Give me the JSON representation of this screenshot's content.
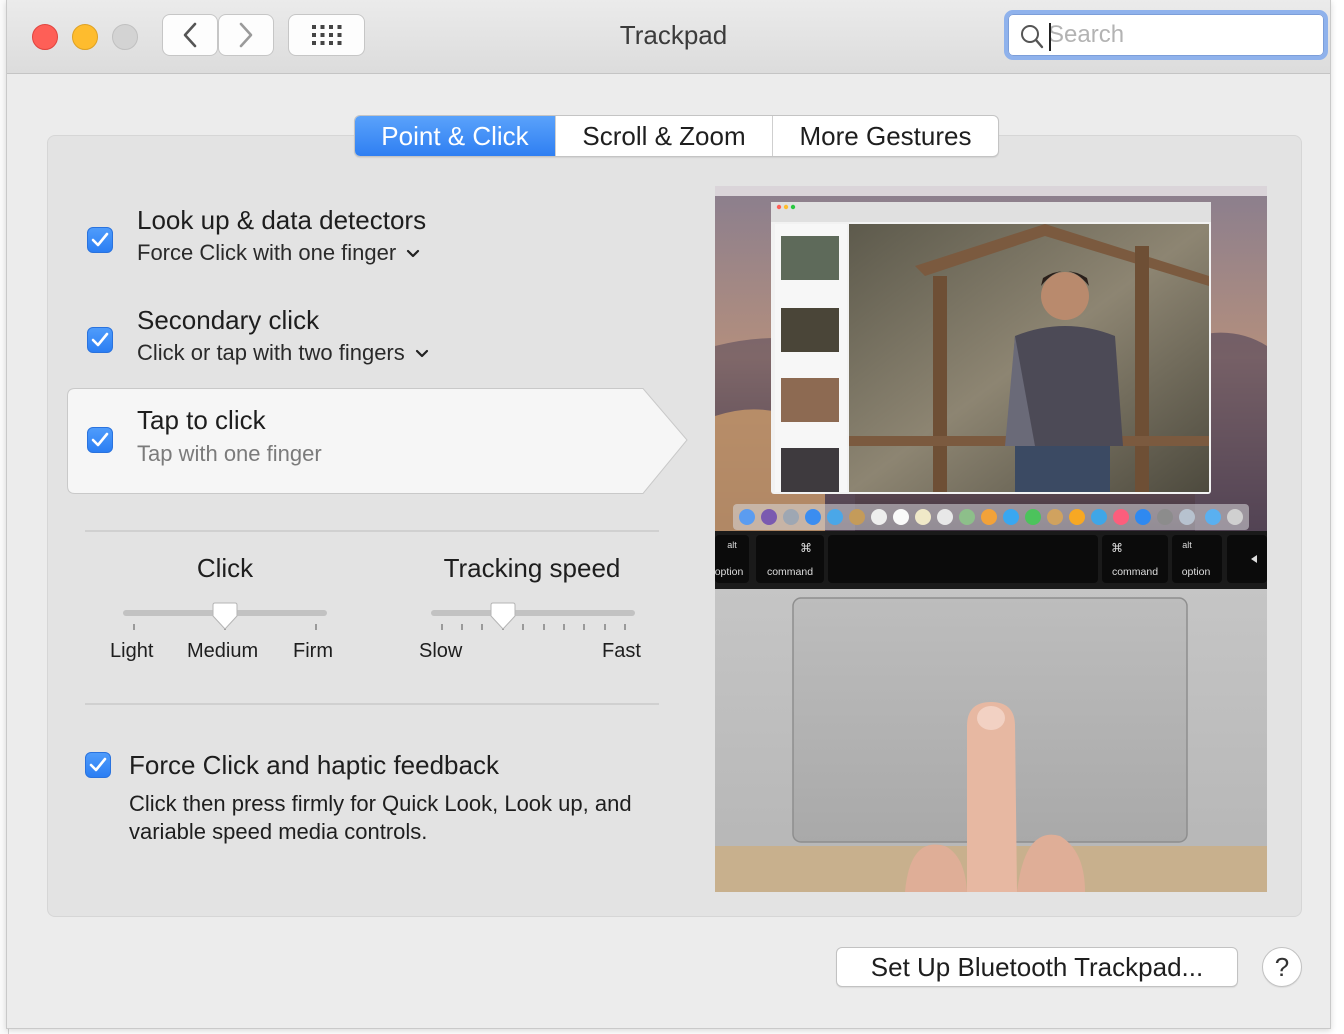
{
  "window": {
    "title": "Trackpad"
  },
  "search": {
    "placeholder": "Search",
    "value": ""
  },
  "tabs": [
    {
      "label": "Point & Click",
      "active": true
    },
    {
      "label": "Scroll & Zoom",
      "active": false
    },
    {
      "label": "More Gestures",
      "active": false
    }
  ],
  "options": [
    {
      "title": "Look up & data detectors",
      "subtitle": "Force Click with one finger",
      "checked": true,
      "has_menu": true
    },
    {
      "title": "Secondary click",
      "subtitle": "Click or tap with two fingers",
      "checked": true,
      "has_menu": true
    },
    {
      "title": "Tap to click",
      "subtitle": "Tap with one finger",
      "checked": true,
      "has_menu": false
    }
  ],
  "click_slider": {
    "label": "Click",
    "ticks": [
      "Light",
      "Medium",
      "Firm"
    ],
    "value": "Medium"
  },
  "tracking_slider": {
    "label": "Tracking speed",
    "min_label": "Slow",
    "max_label": "Fast",
    "tick_count": 10,
    "value_index": 3
  },
  "force_click": {
    "title": "Force Click and haptic feedback",
    "description": "Click then press firmly for Quick Look, Look up, and variable speed media controls.",
    "checked": true
  },
  "preview": {
    "keys": {
      "left_option_alt": "alt",
      "left_option": "option",
      "left_command_symbol": "⌘",
      "left_command": "command",
      "right_command_symbol": "⌘",
      "right_command": "command",
      "right_option_alt": "alt",
      "right_option": "option"
    }
  },
  "buttons": {
    "bluetooth": "Set Up Bluetooth Trackpad...",
    "help": "?"
  },
  "colors": {
    "accent": "#2f7ff2",
    "close": "#fe5f57",
    "minimize": "#febc2e",
    "zoom_disabled": "#d3d3d3"
  }
}
